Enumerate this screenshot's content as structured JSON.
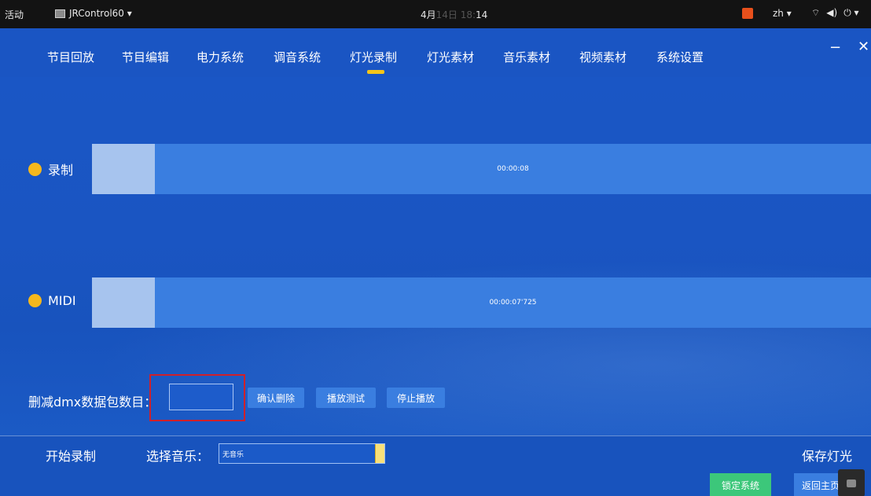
{
  "system_bar": {
    "activities": "活动",
    "app_name": "JRControl60 ▾",
    "clock_prefix": "4月",
    "clock_faded": "14日 18:",
    "clock_time": "14",
    "lang": "zh ▾",
    "icons": [
      "network-icon",
      "volume-icon",
      "power-icon"
    ]
  },
  "nav": {
    "items": [
      {
        "label": "节目回放"
      },
      {
        "label": "节目编辑"
      },
      {
        "label": "电力系统"
      },
      {
        "label": "调音系统"
      },
      {
        "label": "灯光录制"
      },
      {
        "label": "灯光素材"
      },
      {
        "label": "音乐素材"
      },
      {
        "label": "视频素材"
      },
      {
        "label": "系统设置"
      }
    ],
    "active_index": 4,
    "minimize": "−",
    "close": "✕"
  },
  "tracks": {
    "record": {
      "label": "录制",
      "time": "00:00:08"
    },
    "midi": {
      "label": "MIDI",
      "time": "00:00:07'725"
    }
  },
  "dmx": {
    "label": "删减dmx数据包数目：",
    "input_value": "",
    "confirm_delete": "确认删除",
    "play_test": "播放测试",
    "stop_play": "停止播放"
  },
  "footer": {
    "start_record": "开始录制",
    "select_music_label": "选择音乐：",
    "music_value": "无音乐",
    "save_light": "保存灯光",
    "lock_system": "锁定系统",
    "back_home": "返回主页"
  },
  "colors": {
    "background": "#1756c4",
    "track_bar": "#3a7ee0",
    "accent_yellow": "#f5c518",
    "lock_green": "#3cc77a",
    "highlight_red": "#d0202a"
  }
}
